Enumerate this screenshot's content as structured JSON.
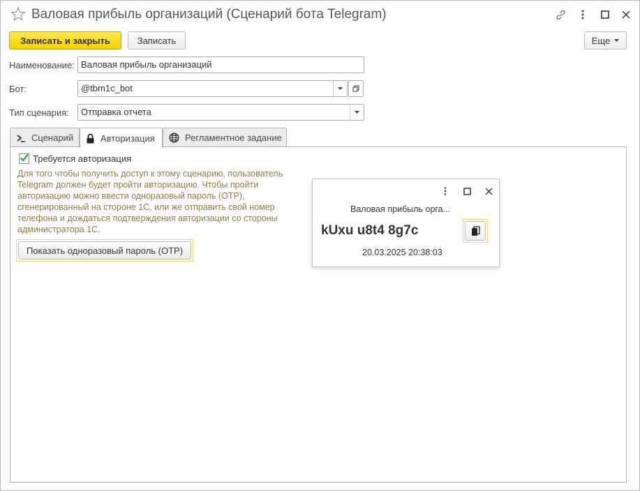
{
  "window": {
    "title": "Валовая прибыль организаций (Сценарий бота Telegram)"
  },
  "commandbar": {
    "save_close_label": "Записать и закрыть",
    "save_label": "Записать",
    "more_label": "Еще"
  },
  "form": {
    "name_label": "Наименование:",
    "name_value": "Валовая прибыль организаций",
    "bot_label": "Бот:",
    "bot_value": "@tbm1c_bot",
    "type_label": "Тип сценария:",
    "type_value": "Отправка отчета"
  },
  "tabs": [
    {
      "label": "Сценарий",
      "icon": "terminal-icon"
    },
    {
      "label": "Авторизация",
      "icon": "lock-icon"
    },
    {
      "label": "Регламентное задание",
      "icon": "globe-icon"
    }
  ],
  "auth": {
    "checkbox_label": "Требуется авторизация",
    "checkbox_checked": true,
    "hint_lines": [
      "Для того чтобы получить доступ к этому сценарию, пользователь",
      "Telegram должен будет пройти авторизацию. Чтобы пройти",
      "авторизацию можно ввести одноразовый пароль (OTP),",
      "сгенерированный на стороне 1С, или же отправить свой номер",
      "телефона и дождаться подтверждения авторизации со стороны",
      "администратора 1С."
    ],
    "otp_button_label": "Показать одноразовый пароль (OTP)"
  },
  "popup": {
    "title": "Валовая прибыль орга...",
    "code": "kUxu u8t4 8g7c",
    "date": "20.03.2025 20:38:03"
  },
  "colors": {
    "accent_yellow": "#f5d100",
    "hint_text": "#8c7a4a",
    "check_green": "#2e9e3e"
  }
}
